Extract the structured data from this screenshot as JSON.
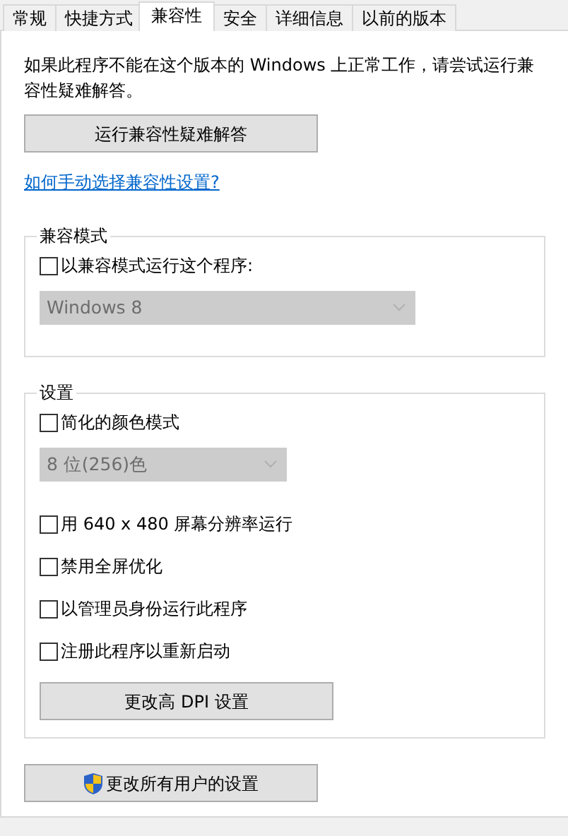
{
  "tabs": [
    {
      "label": "常规",
      "selected": false
    },
    {
      "label": "快捷方式",
      "selected": false
    },
    {
      "label": "兼容性",
      "selected": true
    },
    {
      "label": "安全",
      "selected": false
    },
    {
      "label": "详细信息",
      "selected": false
    },
    {
      "label": "以前的版本",
      "selected": false
    }
  ],
  "description": "如果此程序不能在这个版本的 Windows 上正常工作，请尝试运行兼容性疑难解答。",
  "troubleshoot_button": "运行兼容性疑难解答",
  "help_link": "如何手动选择兼容性设置?",
  "compatibility_mode": {
    "legend": "兼容模式",
    "items": [
      {
        "kind": "checkbox",
        "label": "以兼容模式运行这个程序:",
        "checked": false
      },
      {
        "kind": "dropdown",
        "value": "Windows 8",
        "disabled": true
      }
    ]
  },
  "settings": {
    "legend": "设置",
    "items": [
      {
        "kind": "checkbox",
        "label": "简化的颜色模式",
        "checked": false
      },
      {
        "kind": "dropdown",
        "value": "8 位(256)色",
        "disabled": true
      },
      {
        "kind": "checkbox",
        "label": "用 640 x 480 屏幕分辨率运行",
        "checked": false
      },
      {
        "kind": "checkbox",
        "label": "禁用全屏优化",
        "checked": false
      },
      {
        "kind": "checkbox",
        "label": "以管理员身份运行此程序",
        "checked": false
      },
      {
        "kind": "checkbox",
        "label": "注册此程序以重新启动",
        "checked": false
      },
      {
        "kind": "button",
        "label": "更改高 DPI 设置"
      }
    ]
  },
  "all_users_button": {
    "label": "更改所有用户的设置"
  }
}
